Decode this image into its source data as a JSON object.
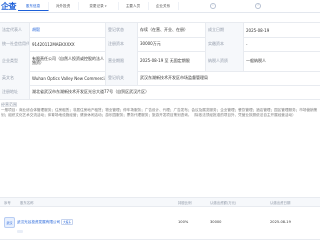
{
  "logo": {
    "mark": "企查",
    "sub": "企查查专业版"
  },
  "tabs": [
    {
      "label": "股东信息",
      "active": true
    },
    {
      "label": "对外投资"
    },
    {
      "label": "变更记录"
    },
    {
      "label": "主要人员"
    },
    {
      "label": "企业关系"
    }
  ],
  "rows": [
    {
      "cells": [
        {
          "label": "法定代表人"
        },
        {
          "value": "胡毅"
        },
        {
          "label": "登记状态"
        },
        {
          "value": "存续（在营、开业、在册）"
        },
        {
          "label": "成立日期"
        },
        {
          "value": "2025-08-19"
        }
      ]
    },
    {
      "cells": [
        {
          "label": "统一社会信用代码"
        },
        {
          "value": "91420112MAEKXXXX"
        },
        {
          "label": "注册资本"
        },
        {
          "value": "30000万元"
        },
        {
          "label": "实缴资本"
        },
        {
          "value": "-"
        }
      ]
    },
    {
      "cells": [
        {
          "label": "企业类型"
        },
        {
          "value": "有限责任公司（自然人投资或控股的法人独资）"
        },
        {
          "label": "营业期限"
        },
        {
          "value": "2025-08-19 至 无固定期限"
        },
        {
          "label": "纳税人资质"
        },
        {
          "value": "一般纳税人"
        }
      ]
    },
    {
      "cells": [
        {
          "label": "英文名"
        },
        {
          "value": "Wuhan Optics Valley New Commercial Development Co., Ltd."
        },
        {
          "label": "登记机关"
        },
        {
          "value": "武汉东湖新技术开发区市场监督管理局"
        }
      ]
    }
  ],
  "address_label": "注册地址",
  "address": "湖北省武汉市东湖新技术开发区光谷大道77号（自贸区武汉片区）",
  "scope_label": "经营范围",
  "scope": "一般项目：商业综合体管理服务；住房租赁；非居住房地产租赁；物业管理；停车场服务；广告设计、代理；广告发布；会议及展览服务；企业管理；餐饮管理；酒店管理；园区管理服务；市场营销策划；组织文化艺术交流活动；体育场地设施经营；健身休闲活动；游乐园服务；票务代理服务；旅游开发项目策划咨询。（除依法须经批准的项目外，凭营业执照依法自主开展经营活动）",
  "shareholders": {
    "headers": [
      "序号",
      "股东名称",
      "持股比例",
      "认缴出资额(万元)",
      "认缴出资日期"
    ],
    "rows": [
      {
        "index": "1",
        "name": "武汉光谷投资发展有限公司",
        "tag": "大股东",
        "ratio": "100%",
        "amount": "30000",
        "date": "2025-08-19"
      }
    ]
  }
}
